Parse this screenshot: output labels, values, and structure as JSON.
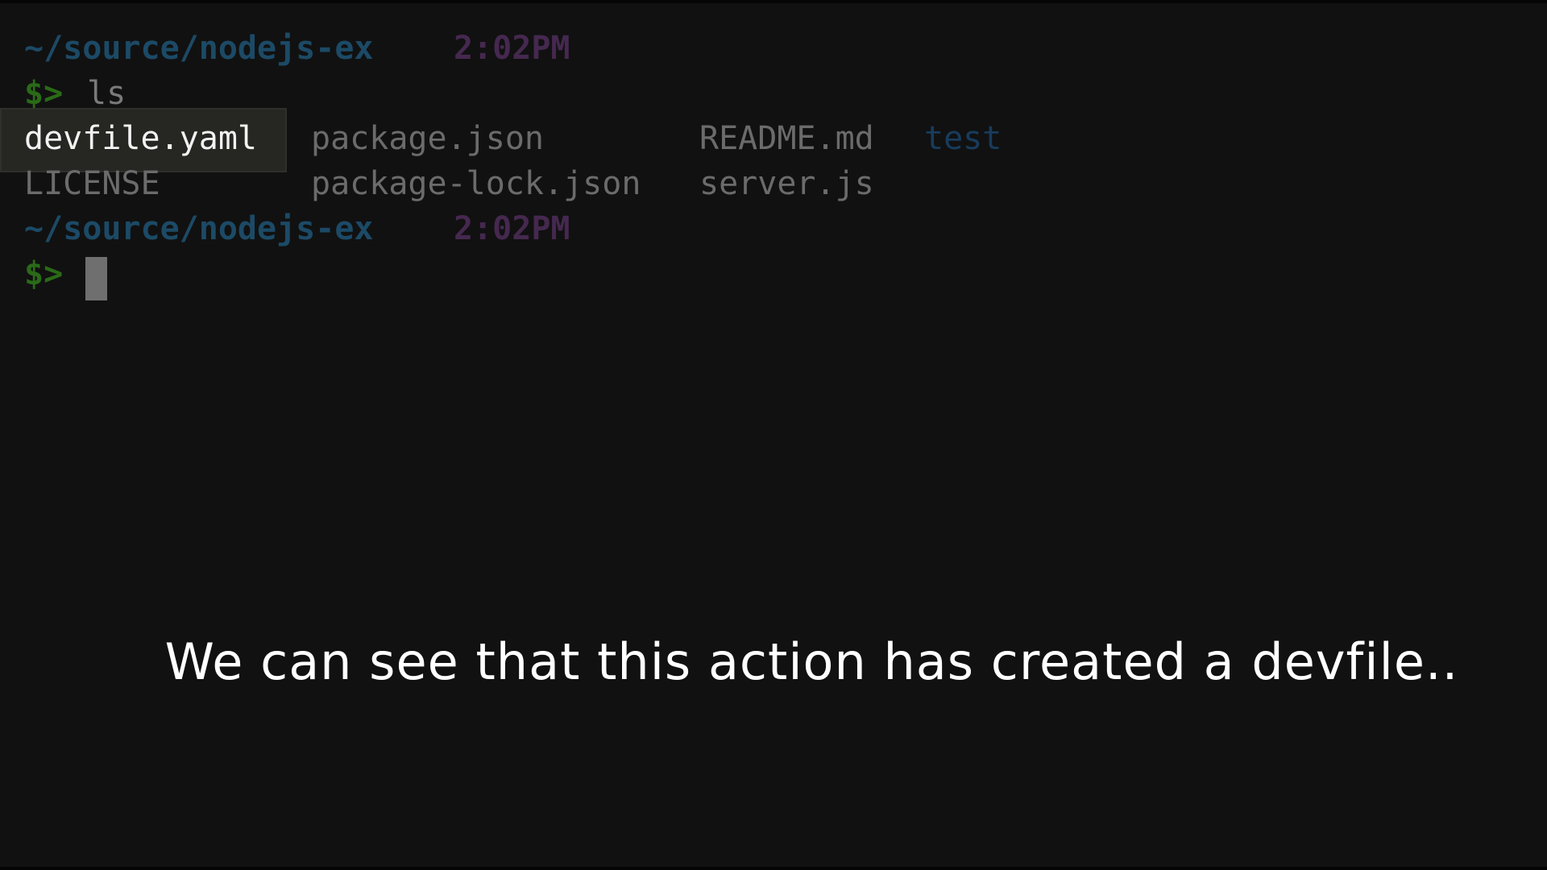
{
  "terminal": {
    "prompt1": {
      "path": "~/source/nodejs-ex",
      "time": "2:02PM"
    },
    "command1": {
      "symbol": "$>",
      "text": "ls"
    },
    "listing": {
      "row1": [
        "devfile.yaml",
        "package.json",
        "README.md",
        "test"
      ],
      "row2": [
        "LICENSE",
        "package-lock.json",
        "server.js"
      ]
    },
    "prompt2": {
      "path": "~/source/nodejs-ex",
      "time": "2:02PM"
    },
    "command2": {
      "symbol": "$>",
      "text": ""
    },
    "highlighted_file": "devfile.yaml"
  },
  "caption": {
    "text": "We can see that this action has created a devfile.."
  },
  "colors": {
    "background": "#111111",
    "path": "#1c4a66",
    "time": "#45284f",
    "prompt_symbol": "#2a6a18",
    "file": "#6b6b6b",
    "directory": "#173c5c",
    "caption": "#ffffff"
  },
  "icons": {
    "cursor": "block-cursor-icon"
  }
}
